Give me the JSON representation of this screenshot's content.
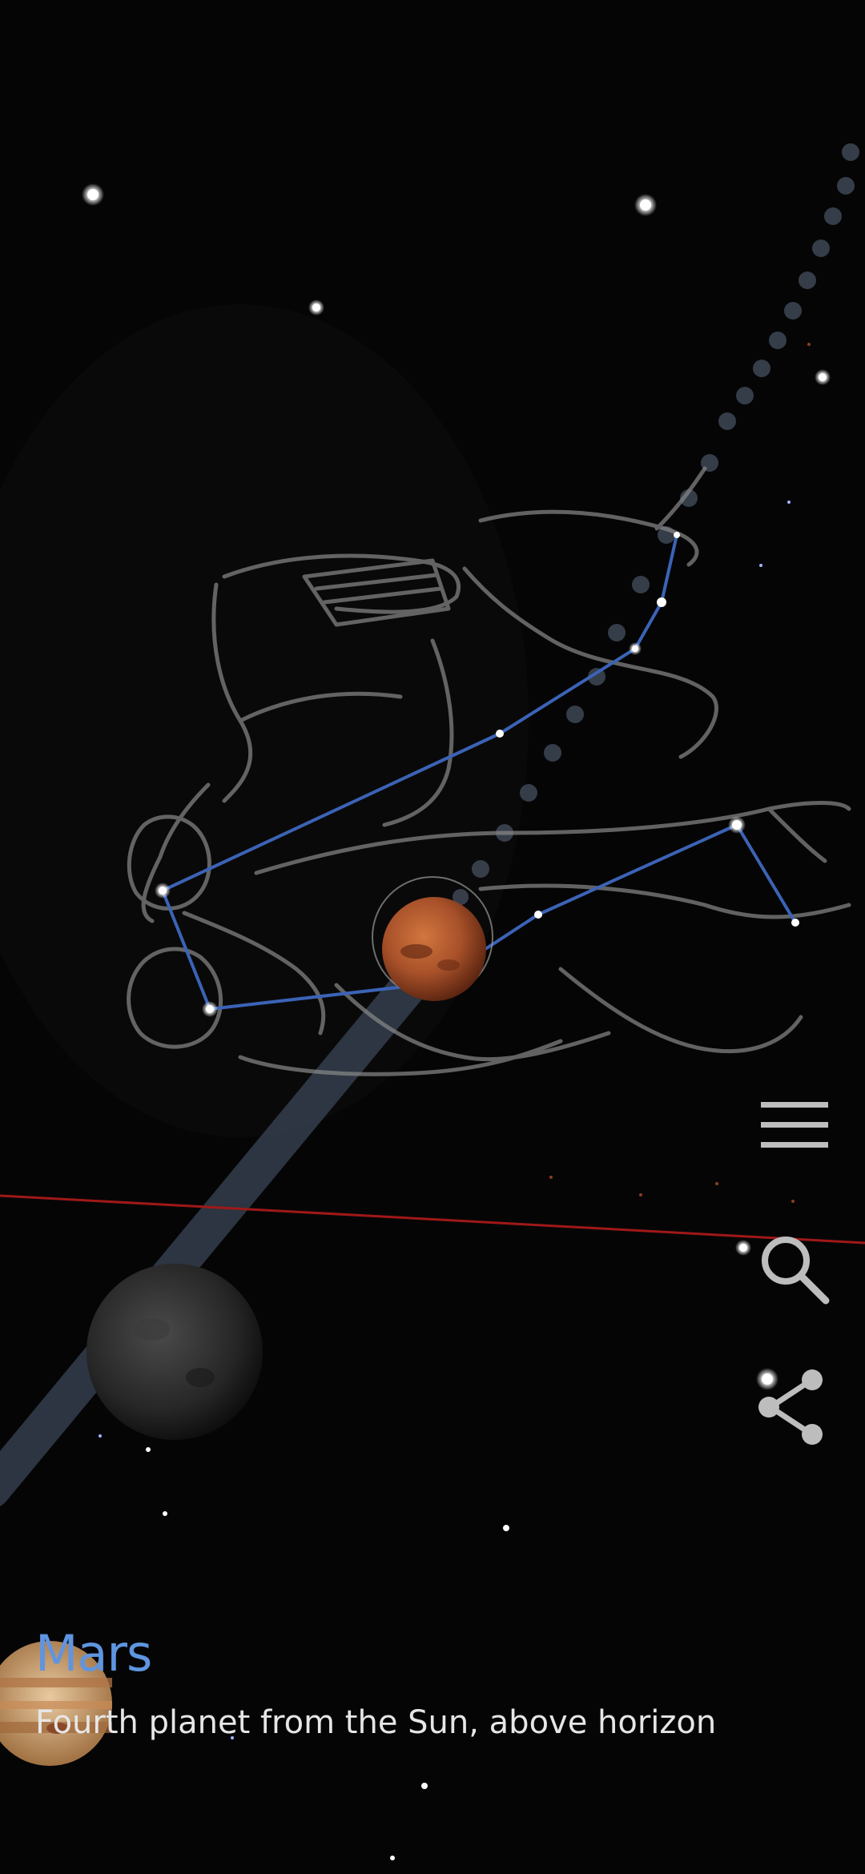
{
  "object": {
    "name": "Mars",
    "description": "Fourth planet from the Sun, above horizon"
  },
  "toolbar": {
    "menu_icon": "hamburger-menu-icon",
    "search_icon": "search-icon",
    "share_icon": "share-icon"
  },
  "colors": {
    "sky": "#050506",
    "constellation_lines": "#3b63b6",
    "constellation_art": "#8a8a8a",
    "horizon_line": "#a01818",
    "ecliptic_band": "#3a4656",
    "title_accent": "#5f95e0",
    "description_text": "#e6e6e6"
  }
}
